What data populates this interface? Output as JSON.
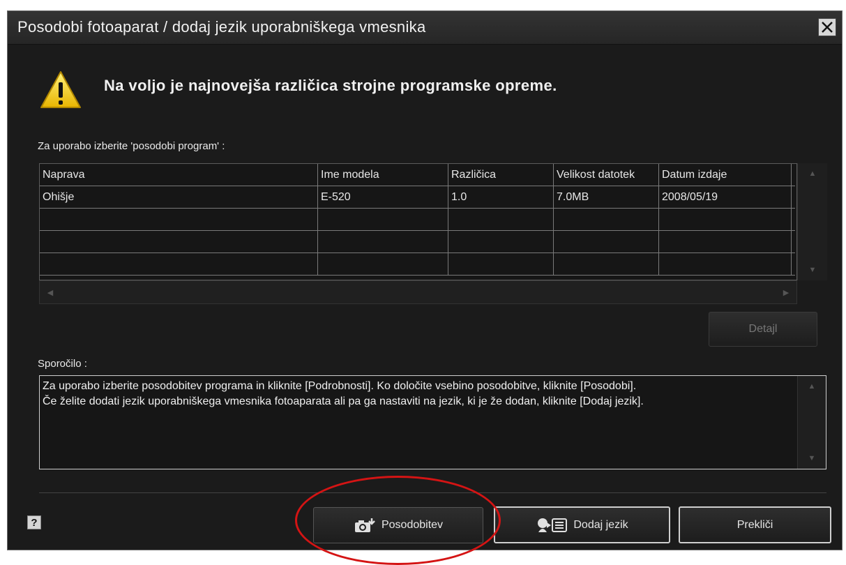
{
  "window": {
    "title": "Posodobi fotoaparat / dodaj jezik uporabniškega vmesnika"
  },
  "headline": "Na voljo je najnovejša različica strojne programske opreme.",
  "select_prompt": "Za uporabo izberite 'posodobi program' :",
  "table": {
    "columns": [
      "Naprava",
      "Ime modela",
      "Različica",
      "Velikost datotek",
      "Datum izdaje"
    ],
    "rows": [
      [
        "Ohišje",
        "E-520",
        "1.0",
        "7.0MB",
        "2008/05/19"
      ]
    ]
  },
  "buttons": {
    "detail": "Detajl",
    "update": "Posodobitev",
    "add_language": "Dodaj jezik",
    "cancel": "Prekliči",
    "help": "?"
  },
  "message": {
    "label": "Sporočilo :",
    "line1": "Za uporabo izberite posodobitev programa in kliknite [Podrobnosti]. Ko določite vsebino posodobitve, kliknite [Posodobi].",
    "line2": "Če želite dodati jezik uporabniškega vmesnika fotoaparata ali pa ga nastaviti na jezik, ki je že dodan, kliknite [Dodaj jezik]."
  },
  "icons": {
    "warning": "warning-icon",
    "close": "close-icon",
    "camera": "camera-update-icon",
    "language": "add-language-icon"
  },
  "colors": {
    "window_bg": "#1b1b1b",
    "annotation": "#d41414"
  }
}
